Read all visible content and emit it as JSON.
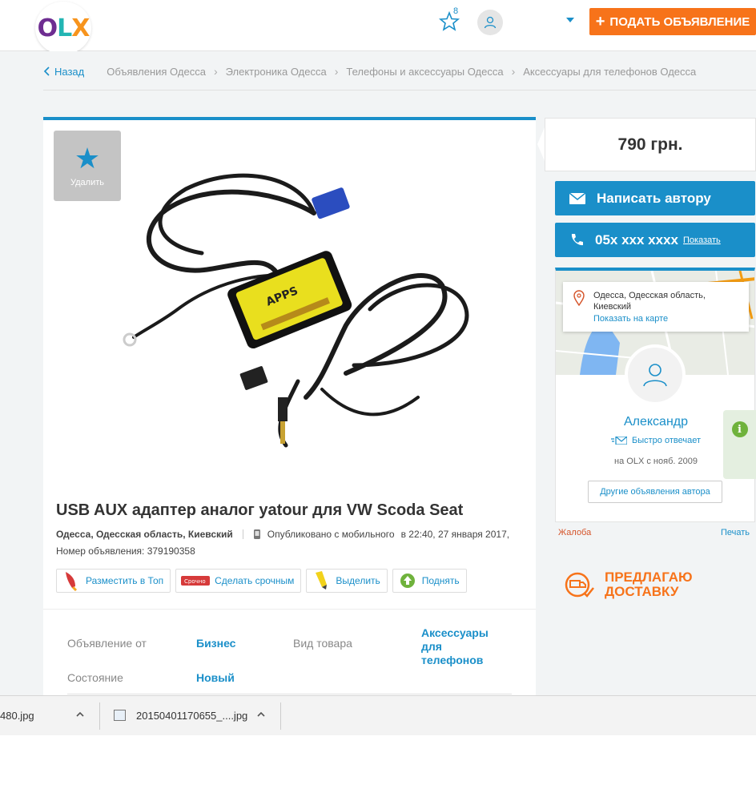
{
  "header": {
    "logo": {
      "o": "O",
      "l": "L",
      "x": "X"
    },
    "favorites_count": "8",
    "post_button": {
      "plus": "+",
      "label": "ПОДАТЬ ОБЪЯВЛЕНИЕ"
    }
  },
  "breadcrumbs": {
    "back": "Назад",
    "items": [
      "Объявления Одесса",
      "Электроника Одесса",
      "Телефоны и аксессуары Одесса",
      "Аксессуары для телефонов Одесса"
    ]
  },
  "listing": {
    "delete_label": "Удалить",
    "title": "USB AUX адаптер аналог yatour для VW Scoda Seat",
    "location": "Одесса, Одесская область, Киевский",
    "published": "Опубликовано с мобильного",
    "date": "в 22:40, 27 января 2017,",
    "ad_number": "Номер объявления: 379190358",
    "actions": {
      "top": "Разместить в Топ",
      "urgent": "Сделать срочным",
      "urgent_tag": "Срочно",
      "highlight": "Выделить",
      "raise": "Поднять"
    },
    "params": {
      "offer_from_label": "Объявление от",
      "offer_from_value": "Бизнес",
      "type_label": "Вид товара",
      "type_value_line1": "Аксессуары для",
      "type_value_line2": "телефонов",
      "condition_label": "Состояние",
      "condition_value": "Новый"
    }
  },
  "sidebar": {
    "price": "790 грн.",
    "message_button": "Написать автору",
    "phone": "05x xxx xxxx",
    "phone_show": "Показать",
    "location_line1": "Одесса, Одесская область,",
    "location_line2": "Киевский",
    "show_on_map": "Показать на карте",
    "author_name": "Александр",
    "fast_reply": "Быстро отвечает",
    "member_since": "на OLX с нояб. 2009",
    "other_ads": "Другие объявления автора",
    "complaint": "Жалоба",
    "print": "Печать",
    "delivery_line1": "ПРЕДЛАГАЮ",
    "delivery_line2": "ДОСТАВКУ"
  },
  "downloads": {
    "item1": "480.jpg",
    "item2": "20150401170655_....jpg"
  },
  "colors": {
    "accent": "#1a8fc9",
    "orange": "#f7731a",
    "complaint": "#d5542a"
  }
}
